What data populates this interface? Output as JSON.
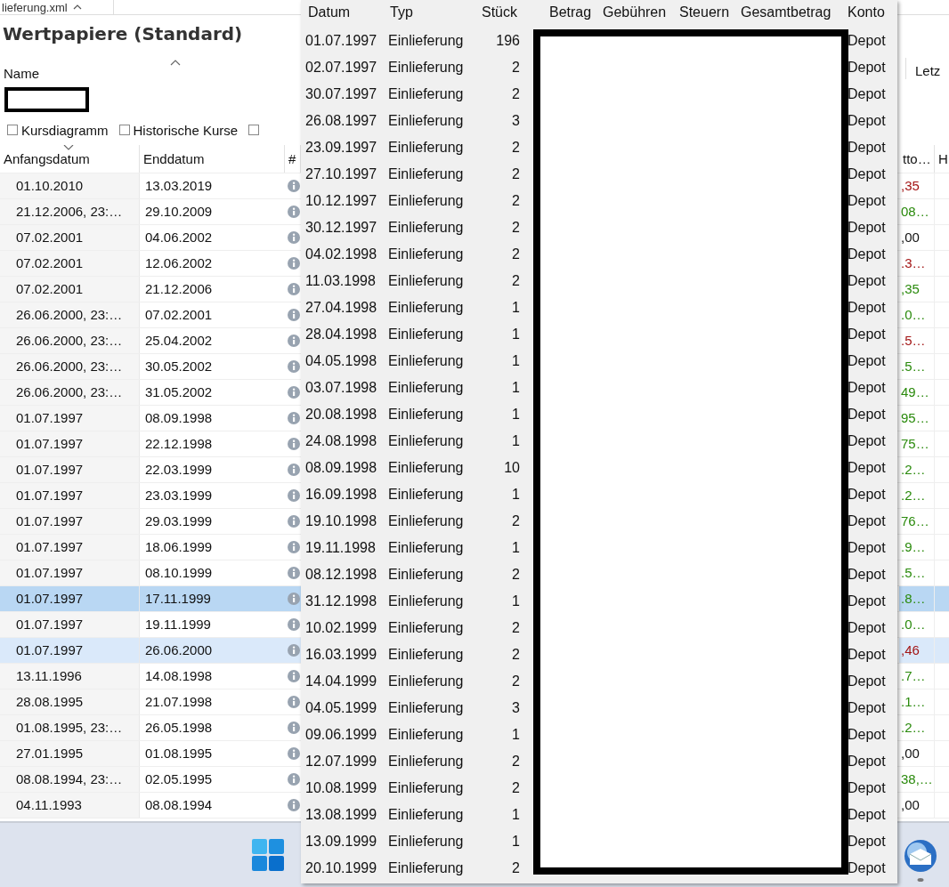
{
  "tab": {
    "label": "lieferung.xml"
  },
  "title": "Wertpapiere (Standard)",
  "filter": {
    "name_label": "Name",
    "column_label": "Letz"
  },
  "views": [
    {
      "label": "Kursdiagramm",
      "checked": false
    },
    {
      "label": "Historische Kurse",
      "checked": false
    },
    {
      "checked": false
    }
  ],
  "table": {
    "columns": [
      "Anfangsdatum",
      "Enddatum",
      "#",
      "tto…",
      "H"
    ],
    "rows": [
      {
        "start": "01.10.2010",
        "end": "13.03.2019",
        "value": ",35",
        "color": "#a31515",
        "selected": false,
        "hovered": false
      },
      {
        "start": "21.12.2006, 23:…",
        "end": "29.10.2009",
        "value": "08…",
        "color": "#2a8a0c",
        "selected": false,
        "hovered": false
      },
      {
        "start": "07.02.2001",
        "end": "04.06.2002",
        "value": ",00",
        "color": "#111111",
        "selected": false,
        "hovered": false
      },
      {
        "start": "07.02.2001",
        "end": "12.06.2002",
        "value": ".3…",
        "color": "#a31515",
        "selected": false,
        "hovered": false
      },
      {
        "start": "07.02.2001",
        "end": "21.12.2006",
        "value": ",35",
        "color": "#2a8a0c",
        "selected": false,
        "hovered": false
      },
      {
        "start": "26.06.2000, 23:…",
        "end": "07.02.2001",
        "value": ".0…",
        "color": "#2a8a0c",
        "selected": false,
        "hovered": false
      },
      {
        "start": "26.06.2000, 23:…",
        "end": "25.04.2002",
        "value": ".5…",
        "color": "#a31515",
        "selected": false,
        "hovered": false
      },
      {
        "start": "26.06.2000, 23:…",
        "end": "30.05.2002",
        "value": ".5…",
        "color": "#2a8a0c",
        "selected": false,
        "hovered": false
      },
      {
        "start": "26.06.2000, 23:…",
        "end": "31.05.2002",
        "value": "49…",
        "color": "#2a8a0c",
        "selected": false,
        "hovered": false
      },
      {
        "start": "01.07.1997",
        "end": "08.09.1998",
        "value": "95…",
        "color": "#2a8a0c",
        "selected": false,
        "hovered": false
      },
      {
        "start": "01.07.1997",
        "end": "22.12.1998",
        "value": "75…",
        "color": "#2a8a0c",
        "selected": false,
        "hovered": false
      },
      {
        "start": "01.07.1997",
        "end": "22.03.1999",
        "value": ".2…",
        "color": "#2a8a0c",
        "selected": false,
        "hovered": false
      },
      {
        "start": "01.07.1997",
        "end": "23.03.1999",
        "value": ".2…",
        "color": "#2a8a0c",
        "selected": false,
        "hovered": false
      },
      {
        "start": "01.07.1997",
        "end": "29.03.1999",
        "value": "76…",
        "color": "#2a8a0c",
        "selected": false,
        "hovered": false
      },
      {
        "start": "01.07.1997",
        "end": "18.06.1999",
        "value": ".9…",
        "color": "#2a8a0c",
        "selected": false,
        "hovered": false
      },
      {
        "start": "01.07.1997",
        "end": "08.10.1999",
        "value": ".5…",
        "color": "#2a8a0c",
        "selected": false,
        "hovered": false
      },
      {
        "start": "01.07.1997",
        "end": "17.11.1999",
        "value": ".8…",
        "color": "#2a8a0c",
        "selected": true,
        "hovered": false
      },
      {
        "start": "01.07.1997",
        "end": "19.11.1999",
        "value": ".0…",
        "color": "#2a8a0c",
        "selected": false,
        "hovered": false
      },
      {
        "start": "01.07.1997",
        "end": "26.06.2000",
        "value": ",46",
        "color": "#a31515",
        "selected": false,
        "hovered": true
      },
      {
        "start": "13.11.1996",
        "end": "14.08.1998",
        "value": ".7…",
        "color": "#2a8a0c",
        "selected": false,
        "hovered": false
      },
      {
        "start": "28.08.1995",
        "end": "21.07.1998",
        "value": ".1…",
        "color": "#2a8a0c",
        "selected": false,
        "hovered": false
      },
      {
        "start": "01.08.1995, 23:…",
        "end": "26.05.1998",
        "value": ".2…",
        "color": "#2a8a0c",
        "selected": false,
        "hovered": false
      },
      {
        "start": "27.01.1995",
        "end": "01.08.1995",
        "value": ",00",
        "color": "#111111",
        "selected": false,
        "hovered": false
      },
      {
        "start": "08.08.1994, 23:…",
        "end": "02.05.1995",
        "value": "38,…",
        "color": "#2a8a0c",
        "selected": false,
        "hovered": false
      },
      {
        "start": "04.11.1993",
        "end": "08.08.1994",
        "value": ",00",
        "color": "#111111",
        "selected": false,
        "hovered": false
      }
    ]
  },
  "popup": {
    "columns": [
      "Datum",
      "Typ",
      "Stück",
      "Betrag",
      "Gebühren",
      "Steuern",
      "Gesamtbetrag",
      "Konto"
    ],
    "rows": [
      {
        "date": "01.07.1997",
        "type": "Einlieferung",
        "shares": "196",
        "account": "Depot"
      },
      {
        "date": "02.07.1997",
        "type": "Einlieferung",
        "shares": "2",
        "account": "Depot"
      },
      {
        "date": "30.07.1997",
        "type": "Einlieferung",
        "shares": "2",
        "account": "Depot"
      },
      {
        "date": "26.08.1997",
        "type": "Einlieferung",
        "shares": "3",
        "account": "Depot"
      },
      {
        "date": "23.09.1997",
        "type": "Einlieferung",
        "shares": "2",
        "account": "Depot"
      },
      {
        "date": "27.10.1997",
        "type": "Einlieferung",
        "shares": "2",
        "account": "Depot"
      },
      {
        "date": "10.12.1997",
        "type": "Einlieferung",
        "shares": "2",
        "account": "Depot"
      },
      {
        "date": "30.12.1997",
        "type": "Einlieferung",
        "shares": "2",
        "account": "Depot"
      },
      {
        "date": "04.02.1998",
        "type": "Einlieferung",
        "shares": "2",
        "account": "Depot"
      },
      {
        "date": "11.03.1998",
        "type": "Einlieferung",
        "shares": "2",
        "account": "Depot"
      },
      {
        "date": "27.04.1998",
        "type": "Einlieferung",
        "shares": "1",
        "account": "Depot"
      },
      {
        "date": "28.04.1998",
        "type": "Einlieferung",
        "shares": "1",
        "account": "Depot"
      },
      {
        "date": "04.05.1998",
        "type": "Einlieferung",
        "shares": "1",
        "account": "Depot"
      },
      {
        "date": "03.07.1998",
        "type": "Einlieferung",
        "shares": "1",
        "account": "Depot"
      },
      {
        "date": "20.08.1998",
        "type": "Einlieferung",
        "shares": "1",
        "account": "Depot"
      },
      {
        "date": "24.08.1998",
        "type": "Einlieferung",
        "shares": "1",
        "account": "Depot"
      },
      {
        "date": "08.09.1998",
        "type": "Einlieferung",
        "shares": "10",
        "account": "Depot"
      },
      {
        "date": "16.09.1998",
        "type": "Einlieferung",
        "shares": "1",
        "account": "Depot"
      },
      {
        "date": "19.10.1998",
        "type": "Einlieferung",
        "shares": "2",
        "account": "Depot"
      },
      {
        "date": "19.11.1998",
        "type": "Einlieferung",
        "shares": "1",
        "account": "Depot"
      },
      {
        "date": "08.12.1998",
        "type": "Einlieferung",
        "shares": "2",
        "account": "Depot"
      },
      {
        "date": "31.12.1998",
        "type": "Einlieferung",
        "shares": "1",
        "account": "Depot"
      },
      {
        "date": "10.02.1999",
        "type": "Einlieferung",
        "shares": "2",
        "account": "Depot"
      },
      {
        "date": "16.03.1999",
        "type": "Einlieferung",
        "shares": "2",
        "account": "Depot"
      },
      {
        "date": "14.04.1999",
        "type": "Einlieferung",
        "shares": "2",
        "account": "Depot"
      },
      {
        "date": "04.05.1999",
        "type": "Einlieferung",
        "shares": "3",
        "account": "Depot"
      },
      {
        "date": "09.06.1999",
        "type": "Einlieferung",
        "shares": "1",
        "account": "Depot"
      },
      {
        "date": "12.07.1999",
        "type": "Einlieferung",
        "shares": "2",
        "account": "Depot"
      },
      {
        "date": "10.08.1999",
        "type": "Einlieferung",
        "shares": "2",
        "account": "Depot"
      },
      {
        "date": "13.08.1999",
        "type": "Einlieferung",
        "shares": "1",
        "account": "Depot"
      },
      {
        "date": "13.09.1999",
        "type": "Einlieferung",
        "shares": "1",
        "account": "Depot"
      },
      {
        "date": "20.10.1999",
        "type": "Einlieferung",
        "shares": "2",
        "account": "Depot"
      }
    ]
  }
}
